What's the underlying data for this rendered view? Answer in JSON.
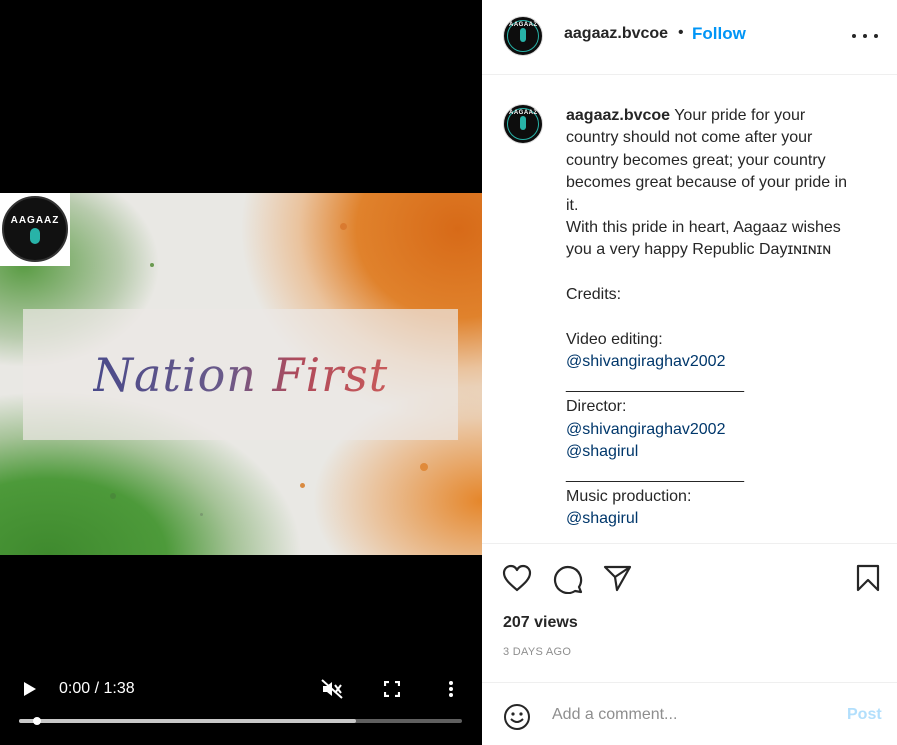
{
  "post": {
    "author": "aagaaz.bvcoe",
    "follow_label": "Follow",
    "dot": "•",
    "caption_lines": [
      "Your pride for your",
      "country should not come after your",
      "country becomes great; your country",
      "becomes great because of your pride in",
      "it.",
      "With this pride in heart, Aagaaz wishes",
      "you a very happy Republic Dayɪɴɪɴɪɴ",
      "",
      "Credits:",
      "",
      "Video editing:"
    ],
    "mention_video_editing": "@shivangiraghav2002",
    "separator": "____________________",
    "director_label": "Director:",
    "mention_director_1": "@shivangiraghav2002",
    "mention_director_2": "@shagirul",
    "music_label": "Music production:",
    "mention_music": "@shagirul",
    "views": "207 views",
    "posted_ago": "3 DAYS AGO"
  },
  "video": {
    "banner_title": "Nation First",
    "logo_wordmark": "AAGAAZ",
    "time_display": "0:00 / 1:38",
    "progress_fraction": 0.0,
    "buffered_fraction": 0.76
  },
  "comment": {
    "placeholder": "Add a comment...",
    "post_label": "Post"
  },
  "colors": {
    "accent": "#0095f6",
    "post_disabled": "#b2dffc",
    "mention": "#00376b",
    "logo_teal": "#28b3a8"
  },
  "icons": [
    "play-icon",
    "mute-icon",
    "fullscreen-icon",
    "kebab-menu-icon",
    "more-options-icon",
    "heart-icon",
    "comment-icon",
    "share-icon",
    "bookmark-icon",
    "emoji-icon"
  ]
}
